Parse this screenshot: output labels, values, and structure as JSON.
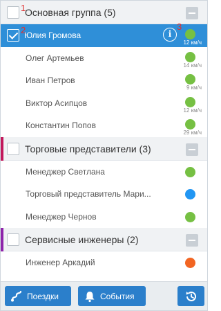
{
  "markers": [
    "1",
    "2",
    "3"
  ],
  "groups": [
    {
      "title": "Основная группа (5)",
      "stripe": "",
      "items": [
        {
          "name": "Юлия Громова",
          "speed": "12 км/ч",
          "dot": "#76c043",
          "selected": true
        },
        {
          "name": "Олег Артемьев",
          "speed": "14 км/ч",
          "dot": "#76c043"
        },
        {
          "name": "Иван Петров",
          "speed": "9 км/ч",
          "dot": "#76c043"
        },
        {
          "name": "Виктор Асипцов",
          "speed": "12 км/ч",
          "dot": "#76c043"
        },
        {
          "name": "Константин Попов",
          "speed": "29 км/ч",
          "dot": "#76c043"
        }
      ]
    },
    {
      "title": "Торговые представители (3)",
      "stripe": "#c2185b",
      "items": [
        {
          "name": "Менеджер Светлана",
          "dot": "#76c043"
        },
        {
          "name": "Торговый представитель Мари...",
          "dot": "#2196f3"
        },
        {
          "name": "Менеджер Чернов",
          "dot": "#76c043"
        }
      ]
    },
    {
      "title": "Сервисные инженеры (2)",
      "stripe": "#8e24aa",
      "items": [
        {
          "name": "Инженер Аркадий",
          "dot": "#f26522"
        }
      ]
    }
  ],
  "bottom": {
    "trips_label": "Поездки",
    "events_label": "События"
  },
  "colors": {
    "accent": "#2f8fd8",
    "button": "#2b7fcb"
  }
}
